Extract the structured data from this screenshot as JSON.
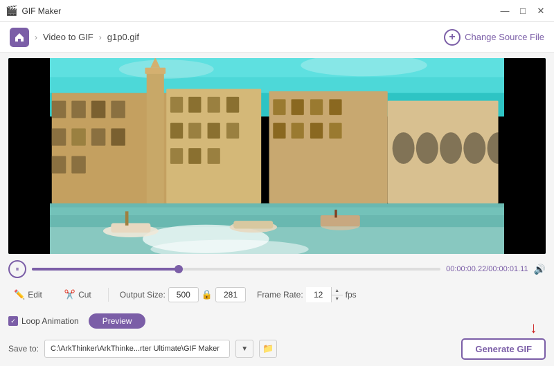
{
  "titleBar": {
    "icon": "🎬",
    "title": "GIF Maker",
    "minimizeLabel": "—",
    "maximizeLabel": "□",
    "closeLabel": "✕"
  },
  "navBar": {
    "homeLabel": "🏠",
    "breadcrumbSeparator": ">",
    "breadcrumbParent": "Video to GIF",
    "breadcrumbChild": "g1p0.gif",
    "changeSourceLabel": "Change Source File"
  },
  "player": {
    "currentTime": "00:00:00.22",
    "totalTime": "00:00:01.11",
    "seekPercent": 36,
    "thumbPercent": 36
  },
  "toolbar": {
    "editLabel": "Edit",
    "cutLabel": "Cut",
    "outputSizeLabel": "Output Size:",
    "outputWidth": "500",
    "outputHeight": "281",
    "frameRateLabel": "Frame Rate:",
    "frameRateValue": "12",
    "frameRateUnit": "fps"
  },
  "loopRow": {
    "checkboxChecked": true,
    "loopLabel": "Loop Animation",
    "previewLabel": "Preview"
  },
  "saveRow": {
    "saveToLabel": "Save to:",
    "savePath": "C:\\ArkThinker\\ArkThinke...rter Ultimate\\GIF Maker",
    "generateLabel": "Generate GIF"
  }
}
